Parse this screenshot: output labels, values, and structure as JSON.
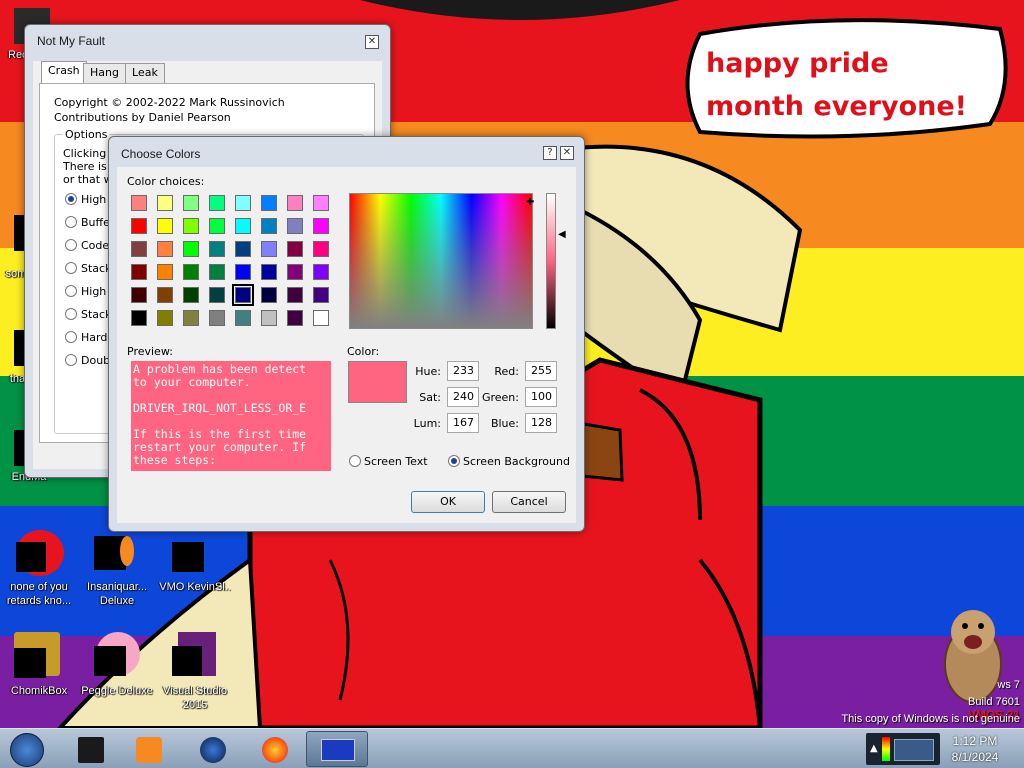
{
  "desktop": {
    "speech_bubble": "happy pride month everyone!",
    "watermark": {
      "line1": "ws 7",
      "line2": "Build 7601",
      "line3": "This copy of Windows is not genuine",
      "brand": "VMOS 21"
    },
    "icons": [
      {
        "label": "Rec",
        "icon": "recycle-bin-icon"
      },
      {
        "label": "some",
        "icon": "app-icon"
      },
      {
        "label": "that",
        "icon": "app-icon"
      },
      {
        "label": "EndMa",
        "icon": "app-icon"
      },
      {
        "label": "none of you retards kno...",
        "icon": "app-icon"
      },
      {
        "label": "Insaniquar... Deluxe",
        "icon": "game-icon"
      },
      {
        "label": "VMO KevinSl..",
        "icon": "app-icon"
      },
      {
        "label": "ChomikBox",
        "icon": "hamster-icon"
      },
      {
        "label": "Peggle Deluxe",
        "icon": "peggle-icon"
      },
      {
        "label": "Visual Studio 2015",
        "icon": "visual-studio-icon"
      }
    ]
  },
  "notmyfault": {
    "title": "Not My Fault",
    "tabs": [
      "Crash",
      "Hang",
      "Leak"
    ],
    "copyright": "Copyright © 2002-2022 Mark Russinovich",
    "contrib": "Contributions by Daniel Pearson",
    "options_label": "Options",
    "desc_lines": [
      "Clicking th",
      "There is a",
      "or that w"
    ],
    "radios": [
      "High I",
      "Buffer",
      "Code c",
      "Stack",
      "High I",
      "Stack",
      "Hardc",
      "Double"
    ]
  },
  "colordlg": {
    "title": "Choose Colors",
    "color_choices_label": "Color choices:",
    "preview_label": "Preview:",
    "color_label": "Color:",
    "preview_text": "A problem has been detect\nto your computer.\n\nDRIVER_IRQL_NOT_LESS_OR_E\n\nIf this is the first time\nrestart your computer. If\nthese steps:",
    "fields": {
      "hue_label": "Hue:",
      "hue": "233",
      "sat_label": "Sat:",
      "sat": "240",
      "lum_label": "Lum:",
      "lum": "167",
      "red_label": "Red:",
      "red": "255",
      "green_label": "Green:",
      "green": "100",
      "blue_label": "Blue:",
      "blue": "128"
    },
    "screen_text": "Screen Text",
    "screen_bg": "Screen Background",
    "ok": "OK",
    "cancel": "Cancel",
    "selected_color": "#ff6480",
    "swatches": [
      [
        "#ff8080",
        "#ffff80",
        "#80ff80",
        "#00ff80",
        "#80ffff",
        "#0080ff",
        "#ff80c0",
        "#ff80ff"
      ],
      [
        "#ff0000",
        "#ffff00",
        "#80ff00",
        "#00ff40",
        "#00ffff",
        "#0080c0",
        "#8080c0",
        "#ff00ff"
      ],
      [
        "#804040",
        "#ff8040",
        "#00ff00",
        "#008080",
        "#004080",
        "#8080ff",
        "#800040",
        "#ff0080"
      ],
      [
        "#800000",
        "#ff8000",
        "#008000",
        "#008040",
        "#0000ff",
        "#0000a0",
        "#800080",
        "#8000ff"
      ],
      [
        "#400000",
        "#804000",
        "#004000",
        "#004040",
        "#000080",
        "#000040",
        "#400040",
        "#400080"
      ],
      [
        "#000000",
        "#808000",
        "#808040",
        "#808080",
        "#408080",
        "#c0c0c0",
        "#400040",
        "#ffffff"
      ]
    ]
  },
  "taskbar": {
    "time": "1:12 PM",
    "date": "8/1/2024",
    "items": [
      "start-orb-icon",
      "app-icon",
      "media-player-icon",
      "globe-icon",
      "firefox-icon",
      "notmyfault-icon"
    ]
  }
}
